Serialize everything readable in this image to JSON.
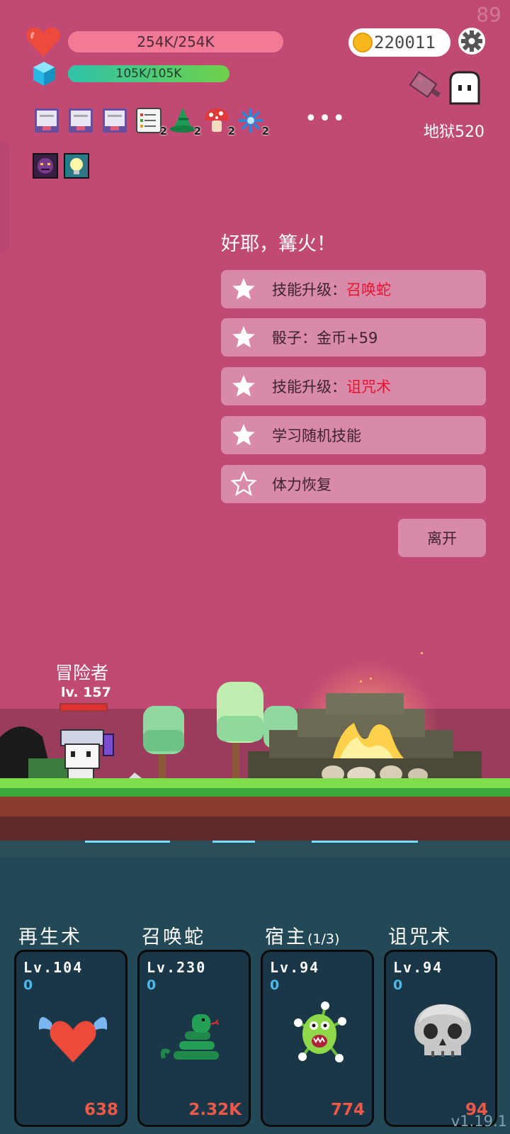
{
  "corner_number": "89",
  "player": {
    "hp_text": "254K/254K",
    "hp_fraction": 1.0,
    "mp_text": "105K/105K",
    "mp_fraction": 1.0,
    "coins": "220011"
  },
  "location": "地狱520",
  "buffs": [
    {
      "icon": "scroll-icon",
      "count": ""
    },
    {
      "icon": "scroll-icon",
      "count": ""
    },
    {
      "icon": "scroll-icon",
      "count": ""
    },
    {
      "icon": "notes-icon",
      "count": "2"
    },
    {
      "icon": "wizard-hat-icon",
      "count": "2"
    },
    {
      "icon": "mushroom-icon",
      "count": "2"
    },
    {
      "icon": "snowflake-icon",
      "count": "2"
    }
  ],
  "more_label": "•••",
  "status_icons": [
    "demon-face-icon",
    "lightbulb-icon"
  ],
  "event": {
    "title": "好耶，篝火！",
    "choices": [
      {
        "text": "技能升级：",
        "highlight": "召唤蛇"
      },
      {
        "text": "骰子：金币+59",
        "highlight": ""
      },
      {
        "text": "技能升级：",
        "highlight": "诅咒术"
      },
      {
        "text": "学习随机技能",
        "highlight": ""
      },
      {
        "text": "体力恢复",
        "highlight": ""
      }
    ],
    "leave_label": "离开"
  },
  "hero": {
    "name": "冒险者",
    "level": "lv. 157",
    "hp_fraction": 1.0
  },
  "skills": [
    {
      "name": "再生术",
      "suffix": "",
      "level": "Lv.104",
      "cooldown": "0",
      "value": "638",
      "icon": "winged-heart-icon"
    },
    {
      "name": "召唤蛇",
      "suffix": "",
      "level": "Lv.230",
      "cooldown": "0",
      "value": "2.32K",
      "icon": "snake-icon"
    },
    {
      "name": "宿主",
      "suffix": "(1/3)",
      "level": "Lv.94",
      "cooldown": "0",
      "value": "774",
      "icon": "germ-monster-icon"
    },
    {
      "name": "诅咒术",
      "suffix": "",
      "level": "Lv.94",
      "cooldown": "0",
      "value": "94",
      "icon": "skull-icon"
    }
  ],
  "version": "v1.19.1",
  "colors": {
    "background": "#c04a73",
    "choice_bg": "#d98aa9",
    "highlight": "#e5142e",
    "card_bg": "#193747",
    "skill_value": "#f25848"
  }
}
